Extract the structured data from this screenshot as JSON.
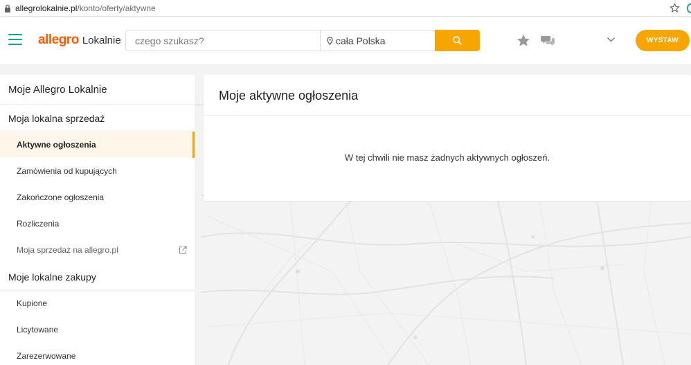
{
  "browser": {
    "url_host": "allegrolokalnie.pl",
    "url_path": "/konto/oferty/aktywne"
  },
  "header": {
    "brand": "allegro",
    "brand_sub": "Lokalnie",
    "search_placeholder": "czego szukasz?",
    "location_placeholder": "cała Polska",
    "add_button": "WYSTAW"
  },
  "sidebar": {
    "title": "Moje Allegro Lokalnie",
    "sales_section": "Moja lokalna sprzedaż",
    "sales_items": [
      "Aktywne ogłoszenia",
      "Zamówienia od kupujących",
      "Zakończone ogłoszenia",
      "Rozliczenia",
      "Moja sprzedaż na allegro.pl"
    ],
    "purchases_section": "Moje lokalne zakupy",
    "purchases_items": [
      "Kupione",
      "Licytowane",
      "Zarezerwowane"
    ]
  },
  "main": {
    "title": "Moje aktywne ogłoszenia",
    "empty_message": "W tej chwili nie masz żadnych aktywnych ogłoszeń."
  },
  "colors": {
    "accent": "#f7a500",
    "brand": "#ff5a00",
    "hamburger": "#00a790"
  },
  "icons": [
    "lock-icon",
    "bookmark-star-icon",
    "hamburger-icon",
    "location-pin-icon",
    "search-icon",
    "favorites-star-icon",
    "chat-icon",
    "chevron-down-icon",
    "external-link-icon"
  ]
}
